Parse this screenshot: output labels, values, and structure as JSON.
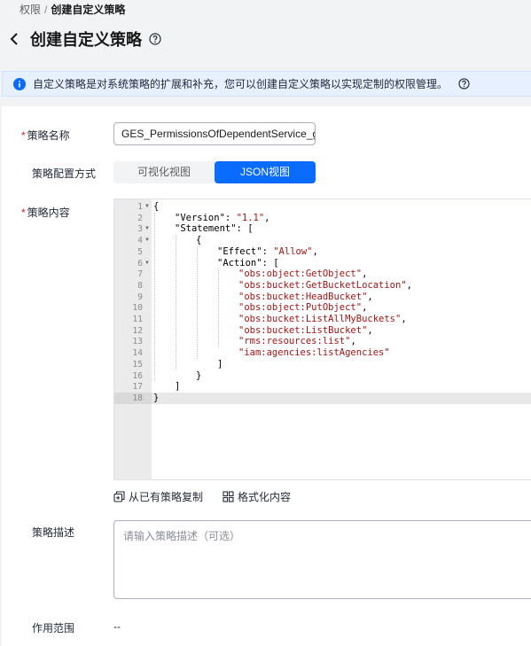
{
  "breadcrumb": {
    "parent": "权限",
    "separator": "/",
    "current": "创建自定义策略"
  },
  "header": {
    "title": "创建自定义策略"
  },
  "banner": {
    "text": "自定义策略是对系统策略的扩展和补充，您可以创建自定义策略以实现定制的权限管理。"
  },
  "form": {
    "name": {
      "label": "策略名称",
      "required_mark": "*",
      "value": "GES_PermissionsOfDependentService_glo"
    },
    "mode": {
      "label": "策略配置方式",
      "options": [
        "可视化视图",
        "JSON视图"
      ],
      "selected": "JSON视图"
    },
    "content": {
      "label": "策略内容",
      "required_mark": "*"
    },
    "tools": {
      "copy_label": "从已有策略复制",
      "format_label": "格式化内容"
    },
    "description": {
      "label": "策略描述",
      "placeholder": "请输入策略描述（可选）"
    },
    "scope": {
      "label": "作用范围",
      "value": "--"
    }
  },
  "editor": {
    "line_numbers": [
      "1",
      "2",
      "3",
      "4",
      "5",
      "6",
      "7",
      "8",
      "9",
      "10",
      "11",
      "12",
      "13",
      "14",
      "15",
      "16",
      "17",
      "18"
    ],
    "lines": [
      {
        "indent": 0,
        "parts": [
          {
            "t": "p",
            "v": "{"
          }
        ]
      },
      {
        "indent": 1,
        "parts": [
          {
            "t": "k",
            "v": "\"Version\""
          },
          {
            "t": "p",
            "v": ": "
          },
          {
            "t": "s",
            "v": "\"1.1\""
          },
          {
            "t": "p",
            "v": ","
          }
        ]
      },
      {
        "indent": 1,
        "parts": [
          {
            "t": "k",
            "v": "\"Statement\""
          },
          {
            "t": "p",
            "v": ": ["
          }
        ]
      },
      {
        "indent": 2,
        "parts": [
          {
            "t": "p",
            "v": "{"
          }
        ]
      },
      {
        "indent": 3,
        "parts": [
          {
            "t": "k",
            "v": "\"Effect\""
          },
          {
            "t": "p",
            "v": ": "
          },
          {
            "t": "s",
            "v": "\"Allow\""
          },
          {
            "t": "p",
            "v": ","
          }
        ]
      },
      {
        "indent": 3,
        "parts": [
          {
            "t": "k",
            "v": "\"Action\""
          },
          {
            "t": "p",
            "v": ": ["
          }
        ]
      },
      {
        "indent": 4,
        "parts": [
          {
            "t": "s",
            "v": "\"obs:object:GetObject\""
          },
          {
            "t": "p",
            "v": ","
          }
        ]
      },
      {
        "indent": 4,
        "parts": [
          {
            "t": "s",
            "v": "\"obs:bucket:GetBucketLocation\""
          },
          {
            "t": "p",
            "v": ","
          }
        ]
      },
      {
        "indent": 4,
        "parts": [
          {
            "t": "s",
            "v": "\"obs:bucket:HeadBucket\""
          },
          {
            "t": "p",
            "v": ","
          }
        ]
      },
      {
        "indent": 4,
        "parts": [
          {
            "t": "s",
            "v": "\"obs:object:PutObject\""
          },
          {
            "t": "p",
            "v": ","
          }
        ]
      },
      {
        "indent": 4,
        "parts": [
          {
            "t": "s",
            "v": "\"obs:bucket:ListAllMyBuckets\""
          },
          {
            "t": "p",
            "v": ","
          }
        ]
      },
      {
        "indent": 4,
        "parts": [
          {
            "t": "s",
            "v": "\"obs:bucket:ListBucket\""
          },
          {
            "t": "p",
            "v": ","
          }
        ]
      },
      {
        "indent": 4,
        "parts": [
          {
            "t": "s",
            "v": "\"rms:resources:list\""
          },
          {
            "t": "p",
            "v": ","
          }
        ]
      },
      {
        "indent": 4,
        "parts": [
          {
            "t": "s",
            "v": "\"iam:agencies:listAgencies\""
          }
        ]
      },
      {
        "indent": 3,
        "parts": [
          {
            "t": "p",
            "v": "]"
          }
        ]
      },
      {
        "indent": 2,
        "parts": [
          {
            "t": "p",
            "v": "}"
          }
        ]
      },
      {
        "indent": 1,
        "parts": [
          {
            "t": "p",
            "v": "]"
          }
        ]
      },
      {
        "indent": 0,
        "parts": [
          {
            "t": "p",
            "v": "}"
          }
        ]
      }
    ],
    "fold_lines": [
      1,
      3,
      4,
      6
    ],
    "active_line": 18
  },
  "icons": [
    "back-icon",
    "help-icon",
    "info-icon",
    "copy-icon",
    "format-icon"
  ],
  "colors": {
    "accent": "#0a6cff",
    "string": "#a31515",
    "required": "#e02020",
    "banner_bg": "#e6f0ff"
  }
}
